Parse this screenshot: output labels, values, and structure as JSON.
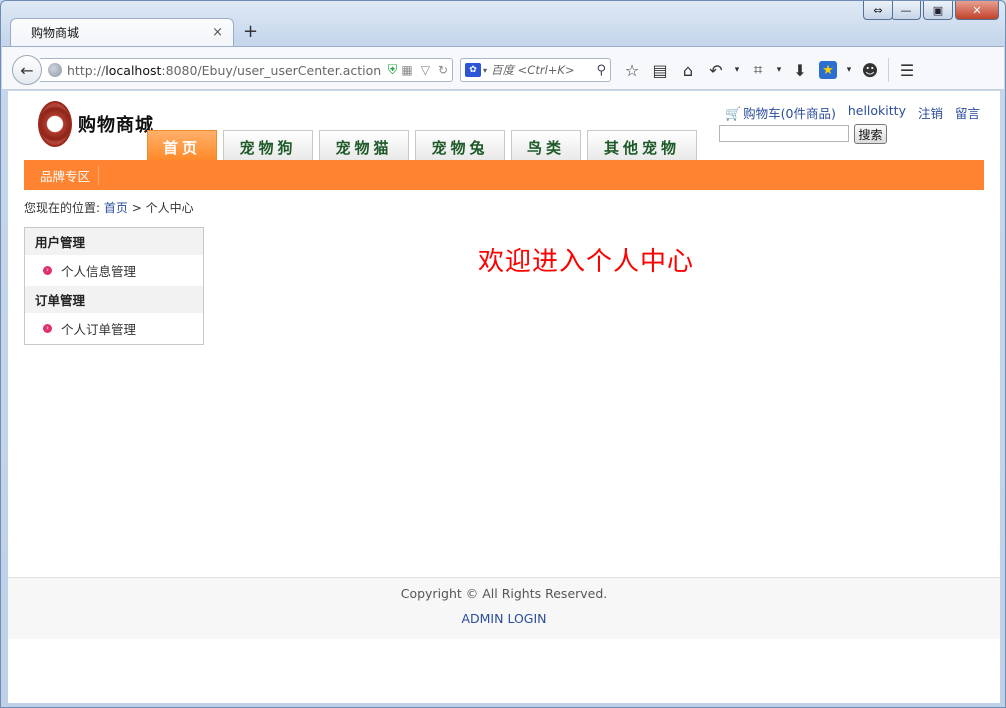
{
  "browser": {
    "tab_title": "购物商城",
    "tab_close": "×",
    "new_tab": "+",
    "url_prefix": "http://",
    "url_host": "localhost",
    "url_rest": ":8080/Ebuy/user_userCenter.action",
    "search_placeholder": "百度 <Ctrl+K>",
    "search_engine_icon": "baidu-paw-icon"
  },
  "site": {
    "logo_text": "购物商城",
    "categories": [
      "首页",
      "宠物狗",
      "宠物猫",
      "宠物兔",
      "鸟类",
      "其他宠物"
    ],
    "active_category_index": 0,
    "cart_label": "购物车(0件商品)",
    "username": "hellokitty",
    "logout_label": "注销",
    "message_label": "留言",
    "search_button": "搜索",
    "brand_link": "品牌专区"
  },
  "breadcrumb": {
    "prefix": "您现在的位置:",
    "home": "首页",
    "separator": ">",
    "current": "个人中心"
  },
  "sidebar": {
    "sections": [
      {
        "title": "用户管理",
        "items": [
          "个人信息管理"
        ]
      },
      {
        "title": "订单管理",
        "items": [
          "个人订单管理"
        ]
      }
    ]
  },
  "main": {
    "welcome": "欢迎进入个人中心"
  },
  "footer": {
    "copyright": "Copyright © All Rights Reserved.",
    "admin_login": "ADMIN LOGIN"
  },
  "colors": {
    "accent": "#ff8330",
    "link": "#2b4d9c",
    "welcome": "#ff0000"
  }
}
